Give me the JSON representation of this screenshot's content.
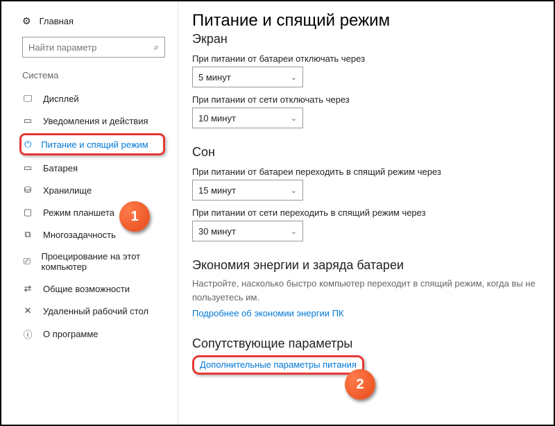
{
  "home_label": "Главная",
  "search_placeholder": "Найти параметр",
  "category_label": "Система",
  "nav": {
    "display": "Дисплей",
    "notifications": "Уведомления и действия",
    "power": "Питание и спящий режим",
    "battery": "Батарея",
    "storage": "Хранилище",
    "tablet": "Режим планшета",
    "multitask": "Многозадачность",
    "projecting": "Проецирование на этот компьютер",
    "shared": "Общие возможности",
    "remote": "Удаленный рабочий стол",
    "about": "О программе"
  },
  "content": {
    "title": "Питание и спящий режим",
    "screen_heading": "Экран",
    "screen_battery_label": "При питании от батареи отключать через",
    "screen_battery_value": "5 минут",
    "screen_plugged_label": "При питании от сети отключать через",
    "screen_plugged_value": "10 минут",
    "sleep_heading": "Сон",
    "sleep_battery_label": "При питании от батареи переходить в спящий режим через",
    "sleep_battery_value": "15 минут",
    "sleep_plugged_label": "При питании от сети переходить в спящий режим через",
    "sleep_plugged_value": "30 минут",
    "energy_heading": "Экономия энергии и заряда батареи",
    "energy_desc": "Настройте, насколько быстро компьютер переходит в спящий режим, когда вы не пользуетесь им.",
    "energy_link": "Подробнее об экономии энергии ПК",
    "related_heading": "Сопутствующие параметры",
    "related_link": "Дополнительные параметры питания"
  },
  "badges": {
    "one": "1",
    "two": "2"
  }
}
